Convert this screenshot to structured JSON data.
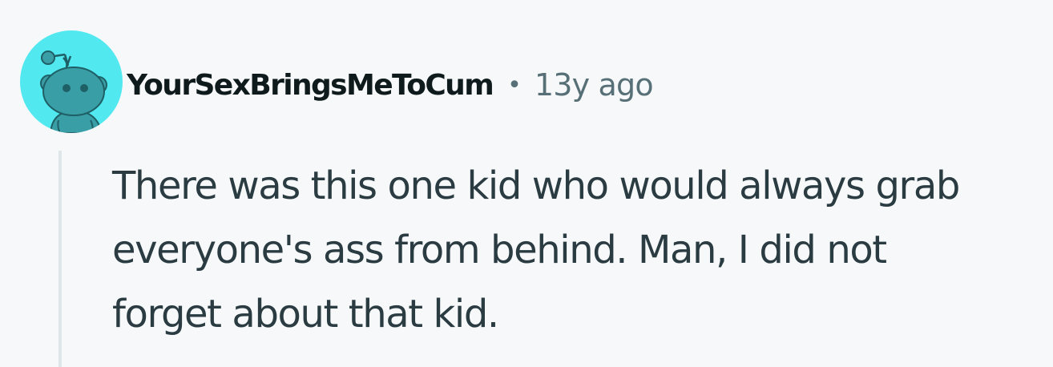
{
  "comment": {
    "author": "YourSexBringsMeToCum",
    "separator": "•",
    "timestamp": "13y ago",
    "body_lines": [
      "There was this one kid who would always grab",
      "everyone's ass from behind. Man, I did not",
      "forget about that kid."
    ],
    "avatar_icon": "snoo-avatar-icon",
    "colors": {
      "background": "#f6f8f9",
      "avatar_bg": "#51e8f0",
      "snoo": "#3a9ea6",
      "username": "#0f1a1c",
      "meta": "#576f76",
      "body_text": "#2a3c42",
      "thread_line": "#dfe6ea"
    }
  }
}
